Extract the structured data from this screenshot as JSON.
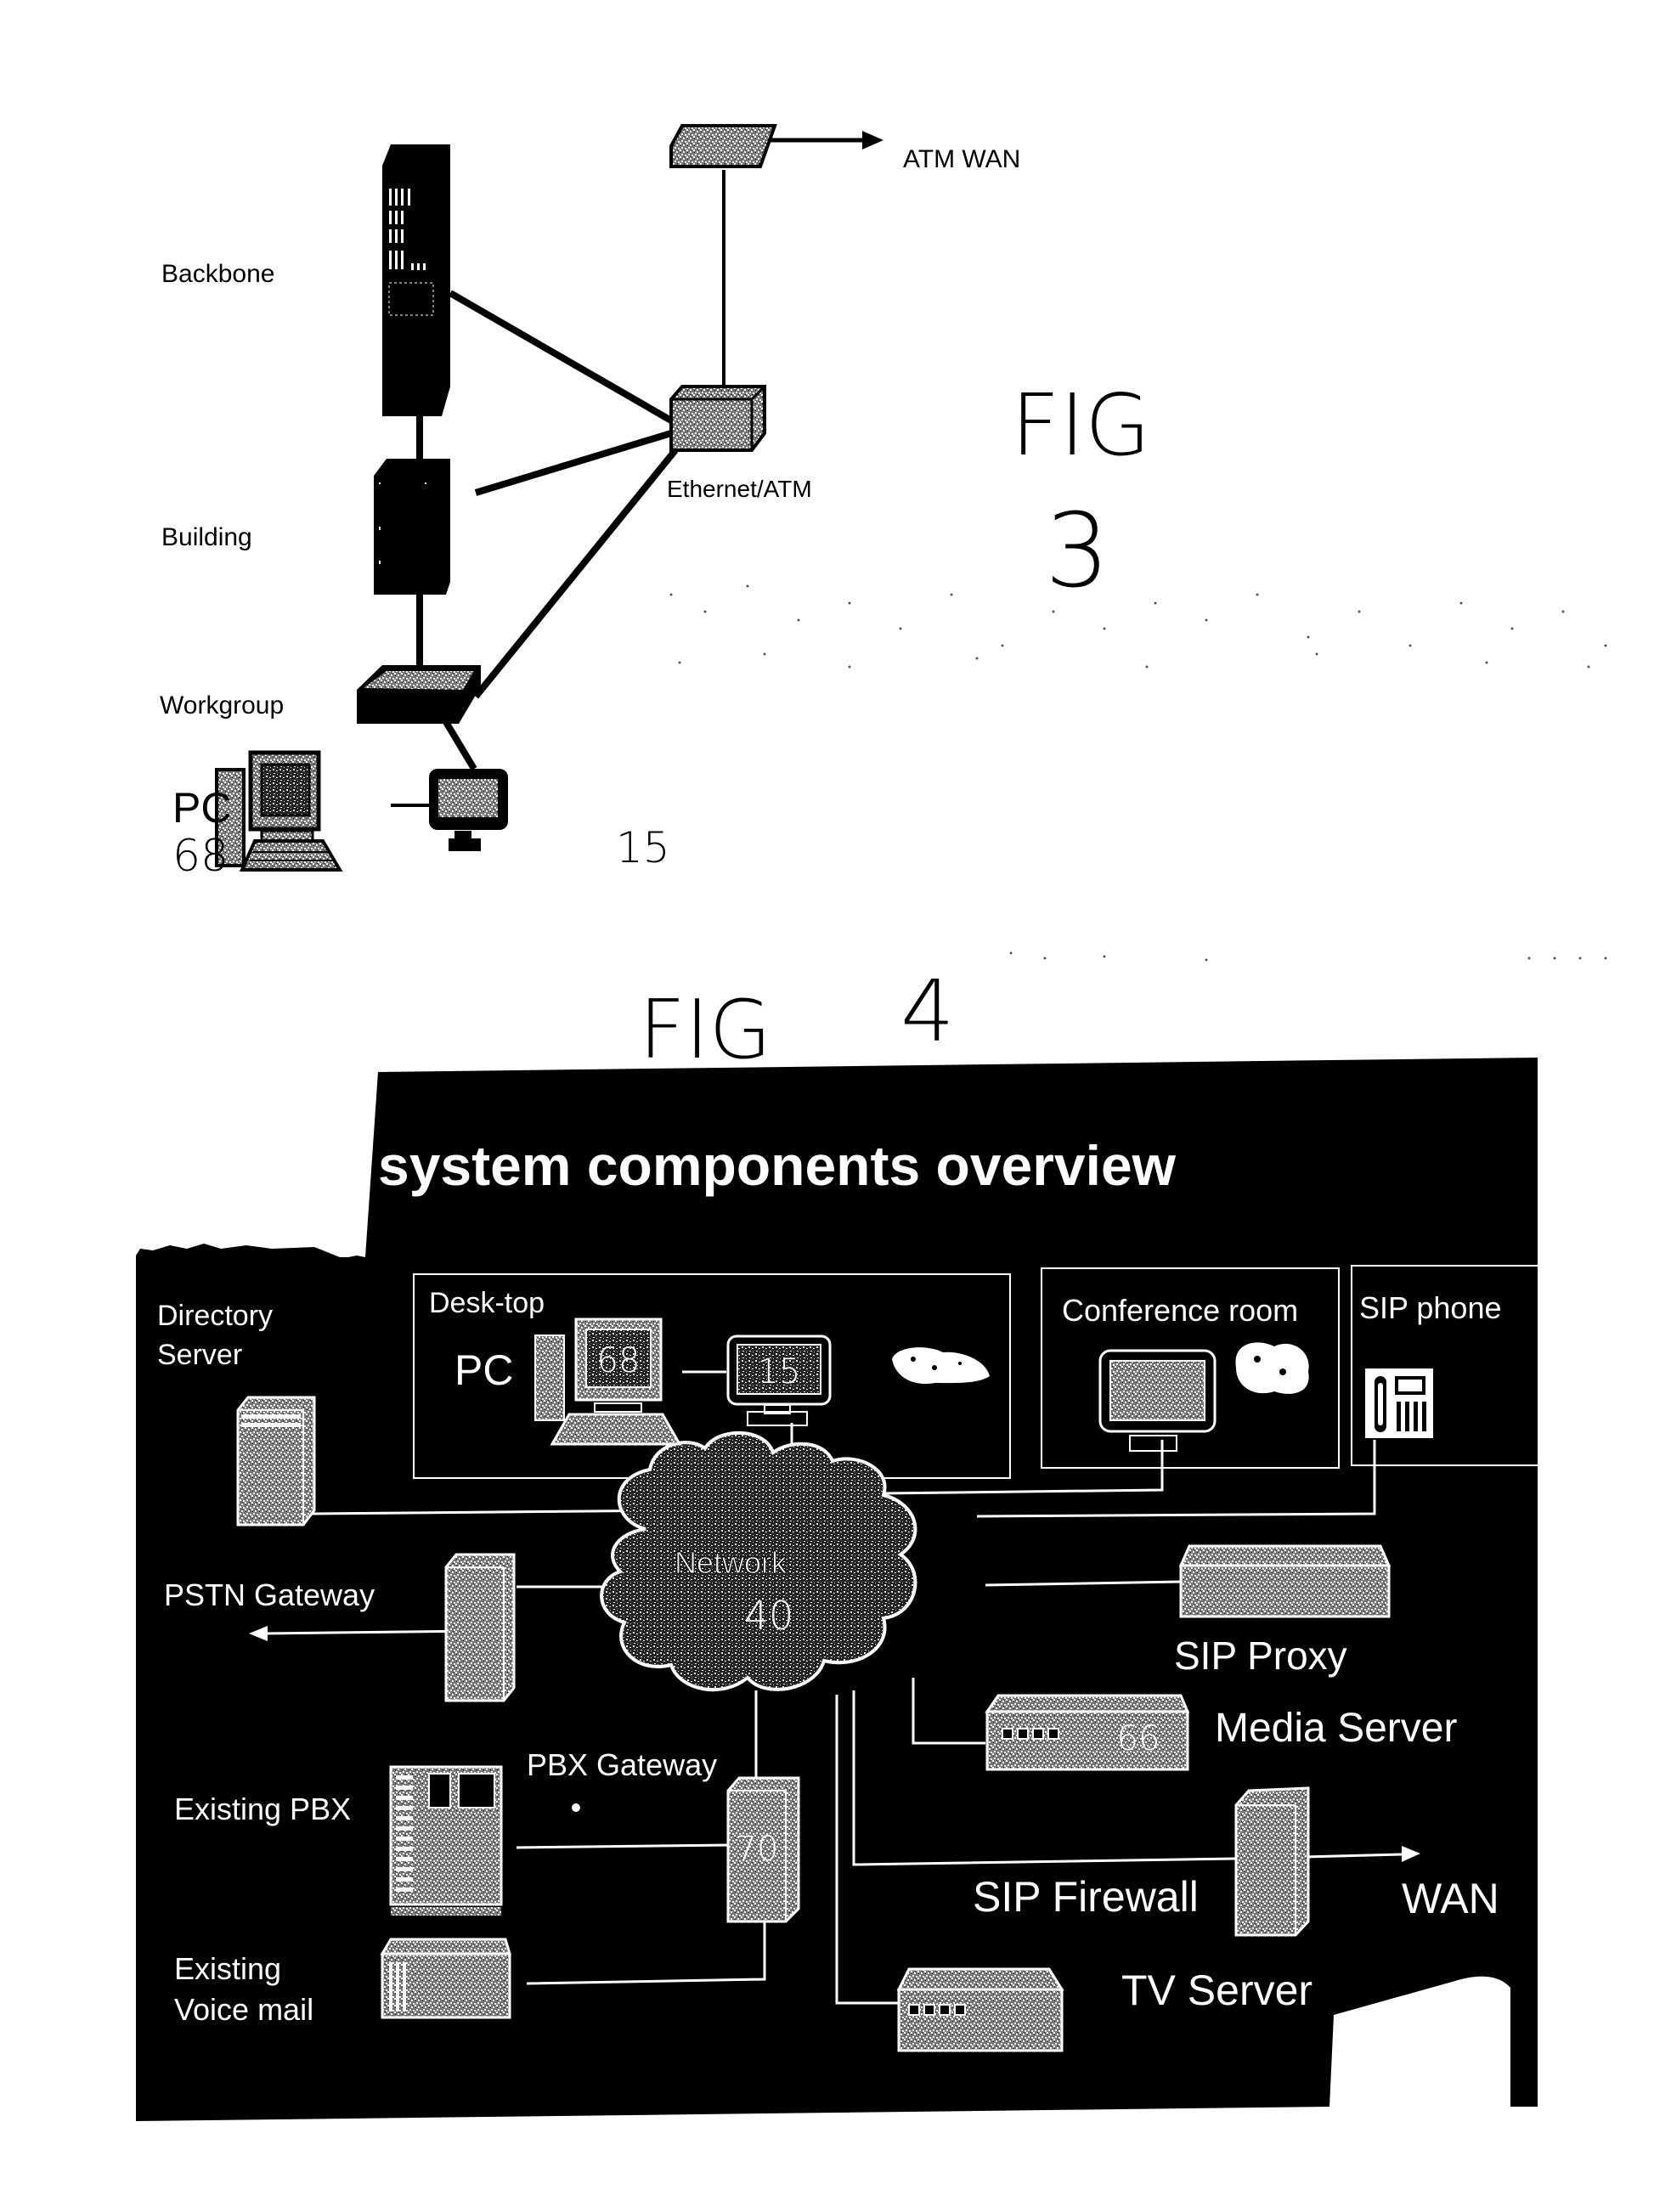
{
  "fig3": {
    "caption": "FIG 3",
    "caption_word": "FIG",
    "caption_number": "3",
    "labels": {
      "backbone": "Backbone",
      "building": "Building",
      "workgroup": "Workgroup",
      "ethernet_atm": "Ethernet/ATM",
      "atm_wan": "ATM WAN",
      "pc": "PC",
      "pc_ref": "68",
      "monitor_ref": "15"
    }
  },
  "fig4": {
    "caption": "FIG 4",
    "caption_word": "FIG",
    "caption_number": "4",
    "title": "system components overview",
    "groups": {
      "desktop": "Desk-top",
      "desktop_pc": "PC",
      "conference_room": "Conference room",
      "sip_phone": "SIP phone"
    },
    "components": {
      "directory_server": [
        "Directory",
        "Server"
      ],
      "pstn_gateway": "PSTN Gateway",
      "network": "Network",
      "network_ref": "40",
      "sip_proxy": "SIP Proxy",
      "media_server": "Media Server",
      "pbx_gateway": "PBX Gateway",
      "pbx_gateway_ref": "70",
      "existing_pbx": "Existing PBX",
      "existing_voicemail": [
        "Existing",
        "Voice mail"
      ],
      "sip_firewall": "SIP Firewall",
      "wan": "WAN",
      "tv_server": "TV Server",
      "desktop_pc_ref": "68",
      "desktop_monitor_ref": "15",
      "media_server_ref": "66"
    }
  },
  "colors": {
    "ink": "#000000",
    "paper": "#ffffff",
    "panel": "#000000",
    "panel_text": "#ffffff",
    "device_fill": "#9a9a9a"
  }
}
